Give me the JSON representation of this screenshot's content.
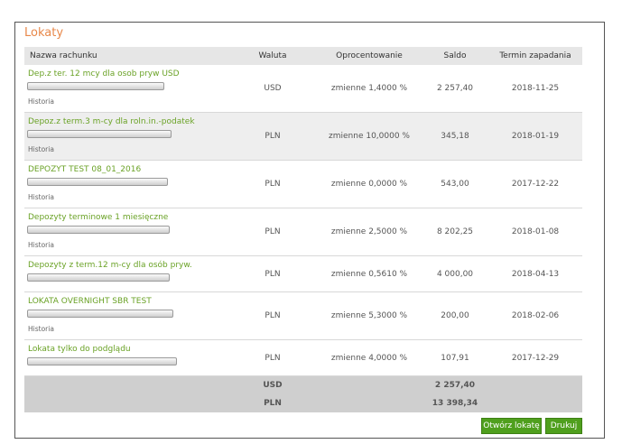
{
  "section_title": "Lokaty",
  "columns": {
    "name": "Nazwa rachunku",
    "currency": "Waluta",
    "interest": "Oprocentowanie",
    "balance": "Saldo",
    "maturity": "Termin zapadania"
  },
  "rows": [
    {
      "name": "Dep.z ter. 12 mcy dla osob pryw USD",
      "history": "Historia",
      "currency": "USD",
      "interest": "zmienne 1,4000 %",
      "balance": "2 257,40",
      "maturity": "2018-11-25"
    },
    {
      "name": "Depoz.z term.3 m-cy dla roln.in.-podatek",
      "history": "Historia",
      "currency": "PLN",
      "interest": "zmienne 10,0000 %",
      "balance": "345,18",
      "maturity": "2018-01-19"
    },
    {
      "name": "DEPOZYT TEST 08_01_2016",
      "history": "Historia",
      "currency": "PLN",
      "interest": "zmienne 0,0000 %",
      "balance": "543,00",
      "maturity": "2017-12-22"
    },
    {
      "name": "Depozyty terminowe 1 miesięczne",
      "history": "Historia",
      "currency": "PLN",
      "interest": "zmienne 2,5000 %",
      "balance": "8 202,25",
      "maturity": "2018-01-08"
    },
    {
      "name": "Depozyty z term.12 m-cy dla osób pryw.",
      "history": "",
      "currency": "PLN",
      "interest": "zmienne 0,5610 %",
      "balance": "4 000,00",
      "maturity": "2018-04-13"
    },
    {
      "name": "LOKATA OVERNIGHT SBR TEST",
      "history": "Historia",
      "currency": "PLN",
      "interest": "zmienne 5,3000 %",
      "balance": "200,00",
      "maturity": "2018-02-06"
    },
    {
      "name": "Lokata tylko do podglądu",
      "history": "",
      "currency": "PLN",
      "interest": "zmienne 4,0000 %",
      "balance": "107,91",
      "maturity": "2017-12-29"
    }
  ],
  "totals": [
    {
      "currency": "USD",
      "balance": "2 257,40"
    },
    {
      "currency": "PLN",
      "balance": "13 398,34"
    }
  ],
  "buttons": {
    "open_deposit": "Otwórz lokatę",
    "print": "Drukuj"
  }
}
